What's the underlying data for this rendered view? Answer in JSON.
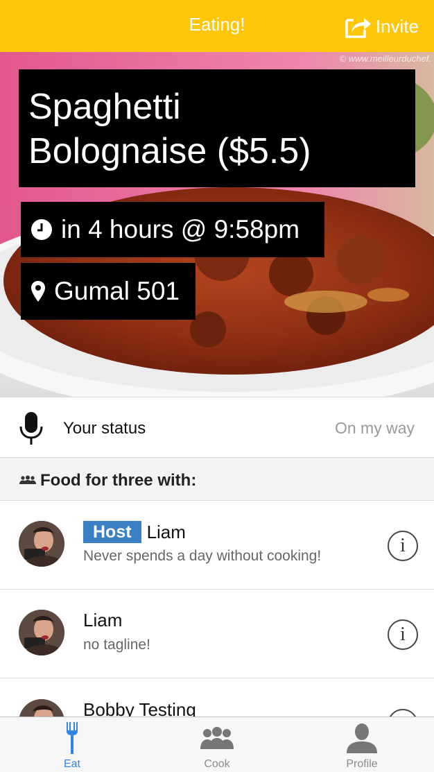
{
  "nav": {
    "title": "Eating!",
    "invite_label": "Invite"
  },
  "event": {
    "title_line1": "Spaghetti",
    "title_line2": "Bolognaise ($5.5)",
    "time": "in 4 hours @ 9:58pm",
    "location": "Gumal 501",
    "watermark": "© www.meilleurduchef."
  },
  "status": {
    "label": "Your status",
    "value": "On my way"
  },
  "section": {
    "title": "Food for three with:"
  },
  "people": [
    {
      "badge": "Host",
      "name": "Liam",
      "tagline": "Never spends a day without cooking!"
    },
    {
      "name": "Liam",
      "tagline": "no tagline!"
    },
    {
      "name": "Bobby Testing"
    }
  ],
  "tabs": [
    {
      "label": "Eat",
      "icon": "fork-icon",
      "active": true
    },
    {
      "label": "Cook",
      "icon": "group-icon",
      "active": false
    },
    {
      "label": "Profile",
      "icon": "person-icon",
      "active": false
    }
  ],
  "colors": {
    "navbar": "#FFC60A",
    "host_badge": "#3B7FC4",
    "active_tab": "#2F86E8"
  }
}
